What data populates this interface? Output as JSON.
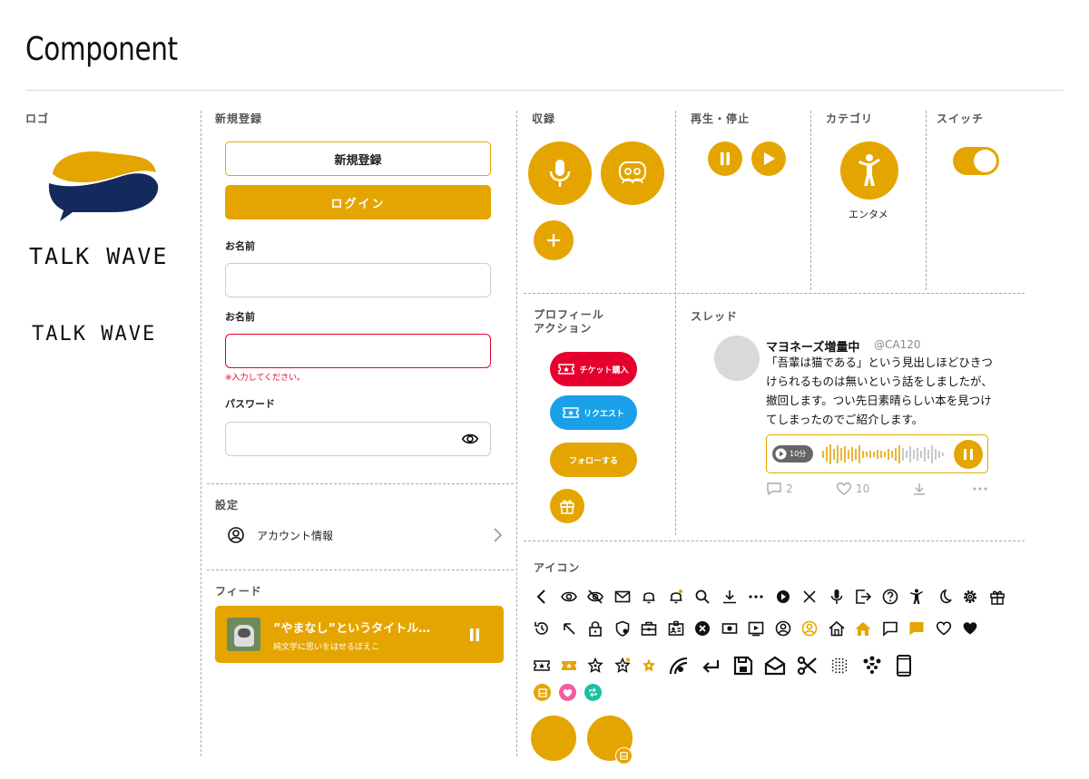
{
  "page_title": "Component",
  "colors": {
    "accent": "#e5a500",
    "navy": "#152a5c",
    "red": "#e5002d",
    "blue": "#1aa0e8",
    "error": "#e5002d"
  },
  "sections": {
    "logo": "ロゴ",
    "signup": "新規登録",
    "record": "収録",
    "playpause": "再生・停止",
    "category": "カテゴリ",
    "switch": "スイッチ",
    "profile_action": "プロフィール\nアクション",
    "thread": "スレッド",
    "settings": "設定",
    "feed": "フィード",
    "icons": "アイコン"
  },
  "logo": {
    "text_large": "TALK WAVE",
    "text_small": "TALK WAVE"
  },
  "signup": {
    "register_button": "新規登録",
    "login_button": "ログイン",
    "name_label_1": "お名前",
    "name_label_2": "お名前",
    "error_text": "※入力してください。",
    "password_label": "パスワード"
  },
  "category": {
    "label": "エンタメ"
  },
  "switch": {
    "state": "on"
  },
  "profile_actions": {
    "ticket_button": "チケット購入",
    "request_button": "リクエスト",
    "follow_button": "フォローする"
  },
  "thread": {
    "user_name": "マヨネーズ増量中",
    "user_handle": "@CA120",
    "body": "「吾輩は猫である」という見出しほどひきつけられるものは無いという話をしましたが、撤回します。つい先日素晴らしい本を見つけてしまったのでご紹介します。",
    "duration": "10分",
    "comment_count": "2",
    "like_count": "10"
  },
  "settings": {
    "account_label": "アカウント情報"
  },
  "feed": {
    "title": "”やまなし”というタイトル…",
    "subtitle": "純文学に思いをはせるぼえこ"
  }
}
